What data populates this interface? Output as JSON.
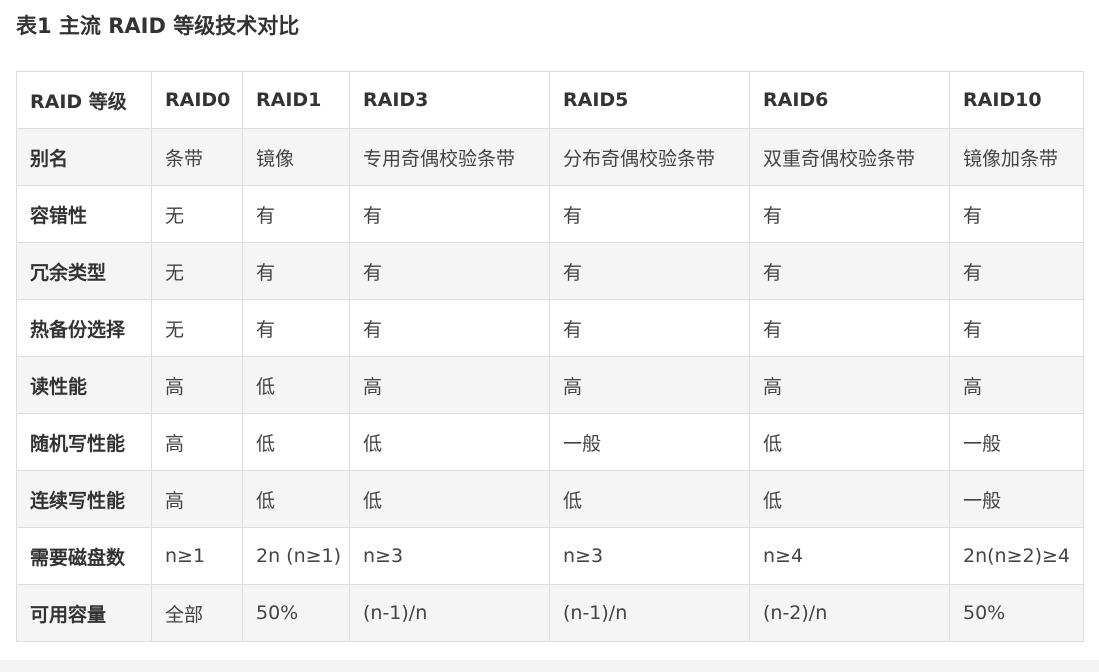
{
  "caption": "表1 主流 RAID 等级技术对比",
  "table": {
    "headers": [
      "RAID 等级",
      "RAID0",
      "RAID1",
      "RAID3",
      "RAID5",
      "RAID6",
      "RAID10"
    ],
    "rows": [
      {
        "label": "别名",
        "cells": [
          "条带",
          "镜像",
          "专用奇偶校验条带",
          "分布奇偶校验条带",
          "双重奇偶校验条带",
          "镜像加条带"
        ]
      },
      {
        "label": "容错性",
        "cells": [
          "无",
          "有",
          "有",
          "有",
          "有",
          "有"
        ]
      },
      {
        "label": "冗余类型",
        "cells": [
          "无",
          "有",
          "有",
          "有",
          "有",
          "有"
        ]
      },
      {
        "label": "热备份选择",
        "cells": [
          "无",
          "有",
          "有",
          "有",
          "有",
          "有"
        ]
      },
      {
        "label": "读性能",
        "cells": [
          "高",
          "低",
          "高",
          "高",
          "高",
          "高"
        ]
      },
      {
        "label": "随机写性能",
        "cells": [
          "高",
          "低",
          "低",
          "一般",
          "低",
          "一般"
        ]
      },
      {
        "label": "连续写性能",
        "cells": [
          "高",
          "低",
          "低",
          "低",
          "低",
          "一般"
        ]
      },
      {
        "label": "需要磁盘数",
        "cells": [
          "n≥1",
          "2n (n≥1)",
          "n≥3",
          "n≥3",
          "n≥4",
          "2n(n≥2)≥4"
        ]
      },
      {
        "label": "可用容量",
        "cells": [
          "全部",
          "50%",
          "(n-1)/n",
          "(n-1)/n",
          "(n-2)/n",
          "50%"
        ]
      }
    ]
  }
}
